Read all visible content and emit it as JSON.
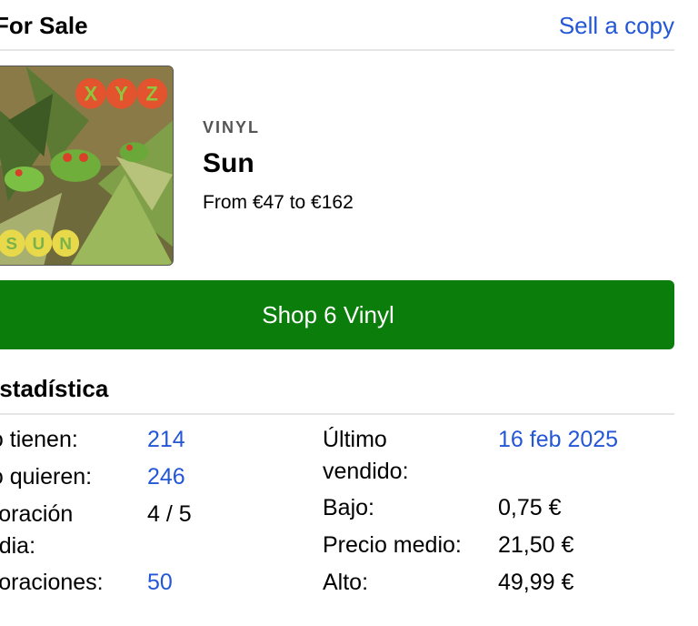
{
  "header": {
    "title": "For Sale",
    "sell_link": "Sell a copy"
  },
  "release": {
    "cover_alt": "XYZ – Sun album cover",
    "cover_text_top": [
      "X",
      "Y",
      "Z"
    ],
    "cover_text_bottom": [
      "S",
      "U",
      "N"
    ],
    "format": "VINYL",
    "title": "Sun",
    "price_range": "From €47 to €162"
  },
  "shop_button": "Shop 6 Vinyl",
  "stats": {
    "title": "Estadística",
    "left": [
      {
        "label": "Lo tienen:",
        "value": "214",
        "link": true
      },
      {
        "label": "Lo quieren:",
        "value": "246",
        "link": true
      },
      {
        "label_line1": "Valoración",
        "label_line2": "media:",
        "value": "4 / 5",
        "link": false
      },
      {
        "label": "Valoraciones:",
        "value": "50",
        "link": true
      }
    ],
    "right": [
      {
        "label_line1": "Último",
        "label_line2": "vendido:",
        "value": "16 feb 2025",
        "link": true
      },
      {
        "label": "Bajo:",
        "value": "0,75 €",
        "link": false
      },
      {
        "label": "Precio medio:",
        "value": "21,50 €",
        "link": false
      },
      {
        "label": "Alto:",
        "value": "49,99 €",
        "link": false
      }
    ]
  },
  "colors": {
    "link": "#2457d6",
    "shop_button_bg": "#0a7d0a",
    "divider": "#e5e5e5"
  }
}
